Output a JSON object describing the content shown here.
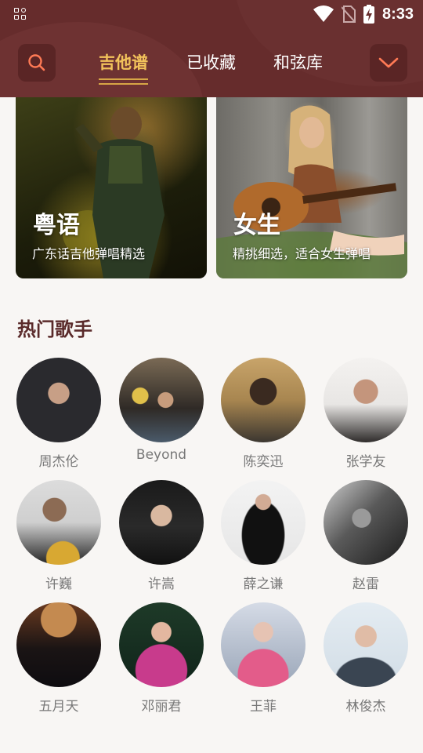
{
  "status_bar": {
    "time": "8:33"
  },
  "header": {
    "tabs": [
      {
        "label": "吉他谱",
        "active": true
      },
      {
        "label": "已收藏",
        "active": false
      },
      {
        "label": "和弦库",
        "active": false
      }
    ],
    "accent_color": "#f2c25b",
    "background_color": "#662c2c"
  },
  "cards": [
    {
      "title": "粤语",
      "subtitle": "广东话吉他弹唱精选"
    },
    {
      "title": "女生",
      "subtitle": "精挑细选，适合女生弹唱"
    }
  ],
  "section": {
    "title": "热门歌手"
  },
  "singers": [
    {
      "name": "周杰伦"
    },
    {
      "name": "Beyond"
    },
    {
      "name": "陈奕迅"
    },
    {
      "name": "张学友"
    },
    {
      "name": "许巍"
    },
    {
      "name": "许嵩"
    },
    {
      "name": "薛之谦"
    },
    {
      "name": "赵雷"
    },
    {
      "name": "五月天"
    },
    {
      "name": "邓丽君"
    },
    {
      "name": "王菲"
    },
    {
      "name": "林俊杰"
    }
  ]
}
